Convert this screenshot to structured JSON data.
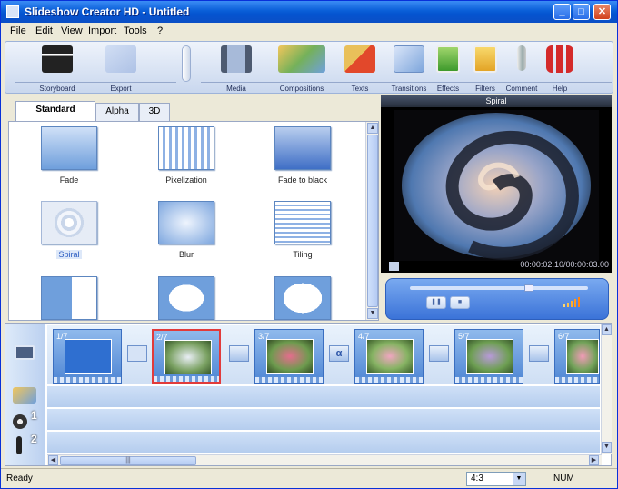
{
  "window": {
    "title": "Slideshow Creator HD - Untitled"
  },
  "menu": [
    "File",
    "Edit",
    "View",
    "Import",
    "Tools",
    "?"
  ],
  "toolbar": {
    "left": [
      {
        "label": "Storyboard",
        "icon": "clapperboard-icon"
      },
      {
        "label": "Export",
        "icon": "export-icon"
      }
    ],
    "right": [
      {
        "label": "Media",
        "icon": "media-icon"
      },
      {
        "label": "Compositions",
        "icon": "compositions-icon"
      },
      {
        "label": "Texts",
        "icon": "text-icon"
      },
      {
        "label": "Transitions",
        "icon": "transitions-icon"
      },
      {
        "label": "Effects",
        "icon": "effects-icon"
      },
      {
        "label": "Filters",
        "icon": "filters-icon"
      },
      {
        "label": "Comment",
        "icon": "microphone-icon"
      },
      {
        "label": "Help",
        "icon": "help-icon"
      }
    ]
  },
  "tabs": [
    "Standard",
    "Alpha",
    "3D"
  ],
  "transitions": [
    {
      "label": "Fade"
    },
    {
      "label": "Pixelization"
    },
    {
      "label": "Fade to black"
    },
    {
      "label": "Spiral",
      "selected": true
    },
    {
      "label": "Blur"
    },
    {
      "label": "Tiling"
    },
    {
      "label": ""
    },
    {
      "label": ""
    },
    {
      "label": ""
    }
  ],
  "preview": {
    "title": "Spiral",
    "time": "00:00:02.10/00:00:03.00",
    "seek_fraction": 0.68
  },
  "timeline": {
    "slides": [
      {
        "num": "1/7"
      },
      {
        "num": "2/7",
        "selected": true
      },
      {
        "num": "3/7"
      },
      {
        "num": "4/7"
      },
      {
        "num": "5/7"
      },
      {
        "num": "6/7"
      }
    ],
    "transition_symbols": [
      "",
      "",
      "α",
      "",
      ""
    ],
    "track_numbers": [
      "1",
      "2"
    ]
  },
  "status": {
    "text": "Ready",
    "aspect_ratio": "4:3",
    "num_indicator": "NUM"
  },
  "colors": {
    "titlebar": "#0a5fd8",
    "selection": "#e23b3b",
    "panel": "#ece9d8"
  }
}
